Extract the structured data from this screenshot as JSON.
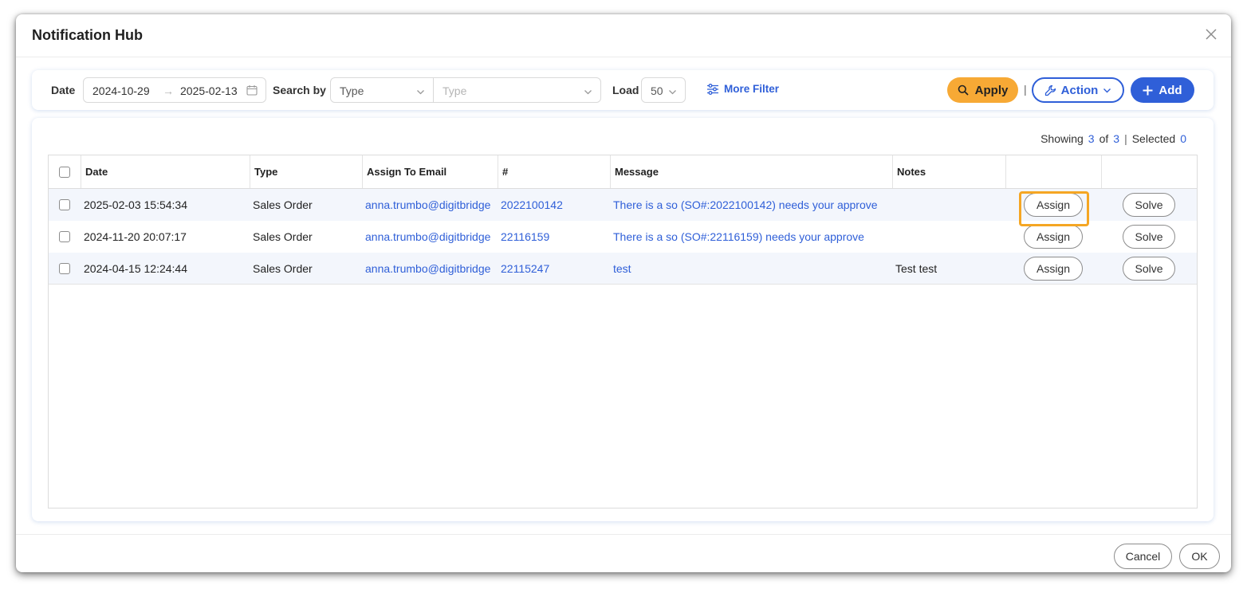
{
  "modal": {
    "title": "Notification Hub",
    "close_icon": "close-icon"
  },
  "filters": {
    "date_label": "Date",
    "date_from": "2024-10-29",
    "date_to": "2025-02-13",
    "date_arrow": "→",
    "search_by_label": "Search by",
    "search_by_select": "Type",
    "search_value_placeholder": "Type",
    "load_label": "Load",
    "load_value": "50",
    "more_filter_label": "More Filter",
    "apply_label": "Apply",
    "divider": "|",
    "action_label": "Action",
    "add_label": "Add"
  },
  "summary": {
    "showing_label": "Showing",
    "showing_count": "3",
    "of_label": "of",
    "total_count": "3",
    "divider": "|",
    "selected_label": "Selected",
    "selected_count": "0"
  },
  "table": {
    "columns": [
      "Date",
      "Type",
      "Assign To Email",
      "#",
      "Message",
      "Notes"
    ],
    "rows": [
      {
        "date": "2025-02-03 15:54:34",
        "type": "Sales Order",
        "email": "anna.trumbo@digitbridge",
        "number": "2022100142",
        "message": "There is a so (SO#:2022100142) needs your approve",
        "notes": "",
        "assign_label": "Assign",
        "solve_label": "Solve"
      },
      {
        "date": "2024-11-20 20:07:17",
        "type": "Sales Order",
        "email": "anna.trumbo@digitbridge",
        "number": "22116159",
        "message": "There is a so (SO#:22116159) needs your approve",
        "notes": "",
        "assign_label": "Assign",
        "solve_label": "Solve"
      },
      {
        "date": "2024-04-15 12:24:44",
        "type": "Sales Order",
        "email": "anna.trumbo@digitbridge",
        "number": "22115247",
        "message": "test",
        "notes": "Test test",
        "assign_label": "Assign",
        "solve_label": "Solve"
      }
    ]
  },
  "footer": {
    "cancel_label": "Cancel",
    "ok_label": "OK"
  },
  "colors": {
    "accent_blue": "#2f5fd8",
    "apply_orange": "#f7a935",
    "highlight_orange": "#f5a623",
    "row_alt": "#f3f6fc"
  }
}
